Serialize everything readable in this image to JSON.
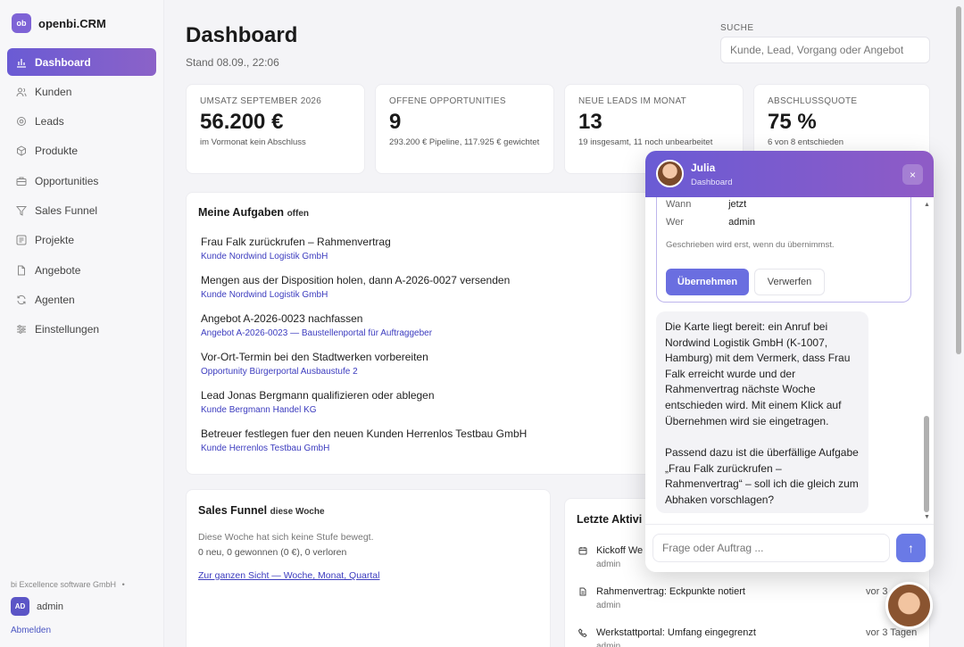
{
  "app": {
    "logo": "ob",
    "name": "openbi.CRM"
  },
  "sidebar": {
    "items": [
      {
        "label": "Dashboard",
        "icon": "chart-icon"
      },
      {
        "label": "Kunden",
        "icon": "users-icon"
      },
      {
        "label": "Leads",
        "icon": "target-icon"
      },
      {
        "label": "Produkte",
        "icon": "box-icon"
      },
      {
        "label": "Opportunities",
        "icon": "briefcase-icon"
      },
      {
        "label": "Sales Funnel",
        "icon": "funnel-icon"
      },
      {
        "label": "Projekte",
        "icon": "list-icon"
      },
      {
        "label": "Angebote",
        "icon": "document-icon"
      },
      {
        "label": "Agenten",
        "icon": "refresh-icon"
      },
      {
        "label": "Einstellungen",
        "icon": "sliders-icon"
      }
    ],
    "company": "bi Excellence software GmbH",
    "company_dot": "•",
    "user_initials": "AD",
    "user_name": "admin",
    "logout": "Abmelden"
  },
  "header": {
    "title": "Dashboard",
    "stand": "Stand 08.09., 22:06",
    "search_label": "SUCHE",
    "search_placeholder": "Kunde, Lead, Vorgang oder Angebot"
  },
  "kpis": [
    {
      "label": "UMSATZ SEPTEMBER 2026",
      "value": "56.200 €",
      "sub": "im Vormonat kein Abschluss"
    },
    {
      "label": "OFFENE OPPORTUNITIES",
      "value": "9",
      "sub": "293.200 € Pipeline, 117.925 € gewichtet"
    },
    {
      "label": "NEUE LEADS IM MONAT",
      "value": "13",
      "sub": "19 insgesamt, 11 noch unbearbeitet"
    },
    {
      "label": "ABSCHLUSSQUOTE",
      "value": "75 %",
      "sub": "6 von 8 entschieden"
    }
  ],
  "tasks": {
    "title": "Meine Aufgaben",
    "subtitle": "offen",
    "items": [
      {
        "title": "Frau Falk zurückrufen – Rahmenvertrag",
        "link": "Kunde Nordwind Logistik GmbH"
      },
      {
        "title": "Mengen aus der Disposition holen, dann A-2026-0027 versenden",
        "link": "Kunde Nordwind Logistik GmbH"
      },
      {
        "title": "Angebot A-2026-0023 nachfassen",
        "link": "Angebot A-2026-0023 — Baustellenportal für Auftraggeber"
      },
      {
        "title": "Vor-Ort-Termin bei den Stadtwerken vorbereiten",
        "link": "Opportunity Bürgerportal Ausbaustufe 2"
      },
      {
        "title": "Lead Jonas Bergmann qualifizieren oder ablegen",
        "link": "Kunde Bergmann Handel KG"
      },
      {
        "title": "Betreuer festlegen fuer den neuen Kunden Herrenlos Testbau GmbH",
        "link": "Kunde Herrenlos Testbau GmbH"
      }
    ]
  },
  "funnel": {
    "title": "Sales Funnel",
    "subtitle": "diese Woche",
    "empty": "Diese Woche hat sich keine Stufe bewegt.",
    "stats": "0 neu, 0 gewonnen (0 €), 0 verloren",
    "link": "Zur ganzen Sicht — Woche, Monat, Quartal"
  },
  "activities": {
    "title": "Letzte Aktivi",
    "items": [
      {
        "icon": "calendar-icon",
        "title": "Kickoff We",
        "who": "admin",
        "time": ""
      },
      {
        "icon": "note-icon",
        "title": "Rahmenvertrag: Eckpunkte notiert",
        "who": "admin",
        "time": "vor 3"
      },
      {
        "icon": "phone-icon",
        "title": "Werkstattportal: Umfang eingegrenzt",
        "who": "admin",
        "time": "vor 3 Tagen"
      }
    ]
  },
  "chat": {
    "name": "Julia",
    "context": "Dashboard",
    "close": "×",
    "proposal": {
      "when_label": "Wann",
      "when_value": "jetzt",
      "who_label": "Wer",
      "who_value": "admin",
      "note": "Geschrieben wird erst, wenn du übernimmst.",
      "accept": "Übernehmen",
      "reject": "Verwerfen"
    },
    "message_p1": "Die Karte liegt bereit: ein Anruf bei Nordwind Logistik GmbH (K-1007, Hamburg) mit dem Vermerk, dass Frau Falk erreicht wurde und der Rahmenvertrag nächste Woche entschieden wird. Mit einem Klick auf Übernehmen wird sie eingetragen.",
    "message_p2": "Passend dazu ist die überfällige Aufgabe „Frau Falk zurückrufen – Rahmenvertrag“ – soll ich die gleich zum Abhaken vorschlagen?",
    "input_placeholder": "Frage oder Auftrag ...",
    "send": "↑"
  },
  "colors": {
    "accent": "#6a5bd4",
    "link": "#3c3cbf"
  }
}
